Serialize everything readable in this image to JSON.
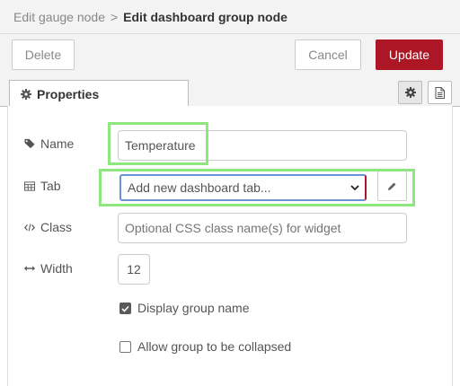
{
  "header": {
    "breadcrumb_prev": "Edit gauge node",
    "breadcrumb_sep": ">",
    "breadcrumb_current": "Edit dashboard group node"
  },
  "actions": {
    "delete_label": "Delete",
    "cancel_label": "Cancel",
    "update_label": "Update"
  },
  "tabs": {
    "properties_label": "Properties",
    "settings_icon": "gear-icon",
    "description_icon": "document-icon"
  },
  "form": {
    "name": {
      "label": "Name",
      "icon": "tag-icon",
      "value": "Temperature"
    },
    "tab": {
      "label": "Tab",
      "icon": "table-icon",
      "selected": "Add new dashboard tab...",
      "edit_icon": "pencil-icon"
    },
    "class": {
      "label": "Class",
      "icon": "code-icon",
      "value": "",
      "placeholder": "Optional CSS class name(s) for widget"
    },
    "width": {
      "label": "Width",
      "icon": "arrows-h-icon",
      "value": "12"
    },
    "display_group_name": {
      "label": "Display group name",
      "checked": true
    },
    "allow_collapse": {
      "label": "Allow group to be collapsed",
      "checked": false
    }
  },
  "colors": {
    "update_button": "#ad1625",
    "highlight": "#8ee67e",
    "select_focus": "#6a90d8"
  }
}
